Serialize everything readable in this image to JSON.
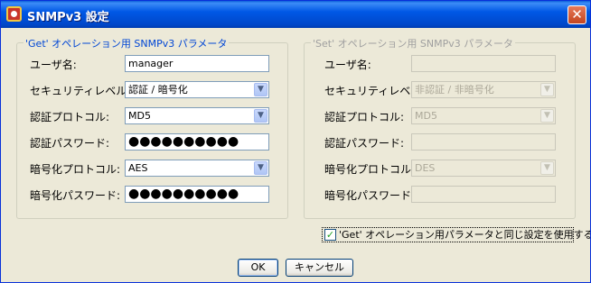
{
  "window": {
    "title": "SNMPv3 設定",
    "close_label": "✕"
  },
  "get_group": {
    "legend": "'Get' オペレーション用 SNMPv3 パラメータ",
    "username_label": "ユーザ名:",
    "username_value": "manager",
    "security_level_label": "セキュリティレベル:",
    "security_level_value": "認証 / 暗号化",
    "auth_protocol_label": "認証プロトコル:",
    "auth_protocol_value": "MD5",
    "auth_password_label": "認証パスワード:",
    "auth_password_value": "●●●●●●●●●●",
    "priv_protocol_label": "暗号化プロトコル:",
    "priv_protocol_value": "AES",
    "priv_password_label": "暗号化パスワード:",
    "priv_password_value": "●●●●●●●●●●"
  },
  "set_group": {
    "legend": "'Set' オペレーション用 SNMPv3 パラメータ",
    "username_label": "ユーザ名:",
    "username_value": "",
    "security_level_label": "セキュリティレベル:",
    "security_level_value": "非認証 / 非暗号化",
    "auth_protocol_label": "認証プロトコル:",
    "auth_protocol_value": "MD5",
    "auth_password_label": "認証パスワード:",
    "auth_password_value": "",
    "priv_protocol_label": "暗号化プロトコル:",
    "priv_protocol_value": "DES",
    "priv_password_label": "暗号化パスワード:",
    "priv_password_value": ""
  },
  "same_settings_checkbox": {
    "label": "'Get' オペレーション用パラメータと同じ設定を使用する(S)",
    "checked": true,
    "mark": "✓"
  },
  "buttons": {
    "ok": "OK",
    "cancel": "キャンセル"
  },
  "icons": {
    "dropdown": "▼"
  },
  "colors": {
    "titlebar": "#0058e6",
    "dialog_bg": "#ece9d8",
    "get_legend": "#0046d5",
    "disabled_text": "#aca899"
  }
}
